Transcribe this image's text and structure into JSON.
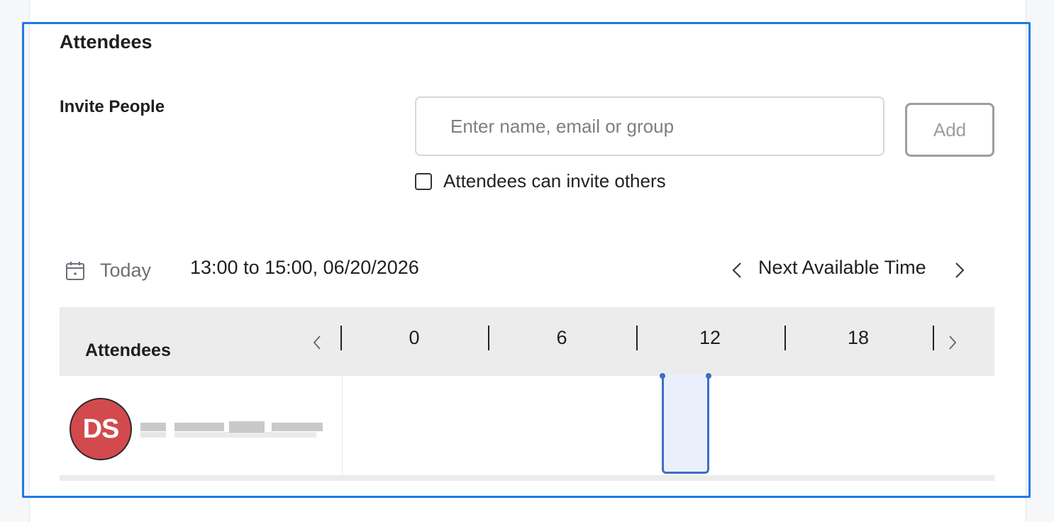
{
  "section": {
    "title": "Attendees"
  },
  "invite": {
    "label": "Invite People",
    "placeholder": "Enter name, email or group",
    "value": "",
    "add_label": "Add",
    "checkbox_label": "Attendees can invite others",
    "checkbox_checked": false
  },
  "schedule": {
    "today_label": "Today",
    "time_range": "13:00 to 15:00, 06/20/2026",
    "next_available_label": "Next Available Time"
  },
  "grid": {
    "header_label": "Attendees",
    "hours": [
      "0",
      "6",
      "12",
      "18"
    ],
    "attendees": [
      {
        "initials": "DS",
        "avatar_color": "#d24a4e"
      }
    ],
    "selection_color": "#3b70c4"
  },
  "colors": {
    "accent": "#1e7ae8",
    "avatar": "#d24a4e"
  }
}
